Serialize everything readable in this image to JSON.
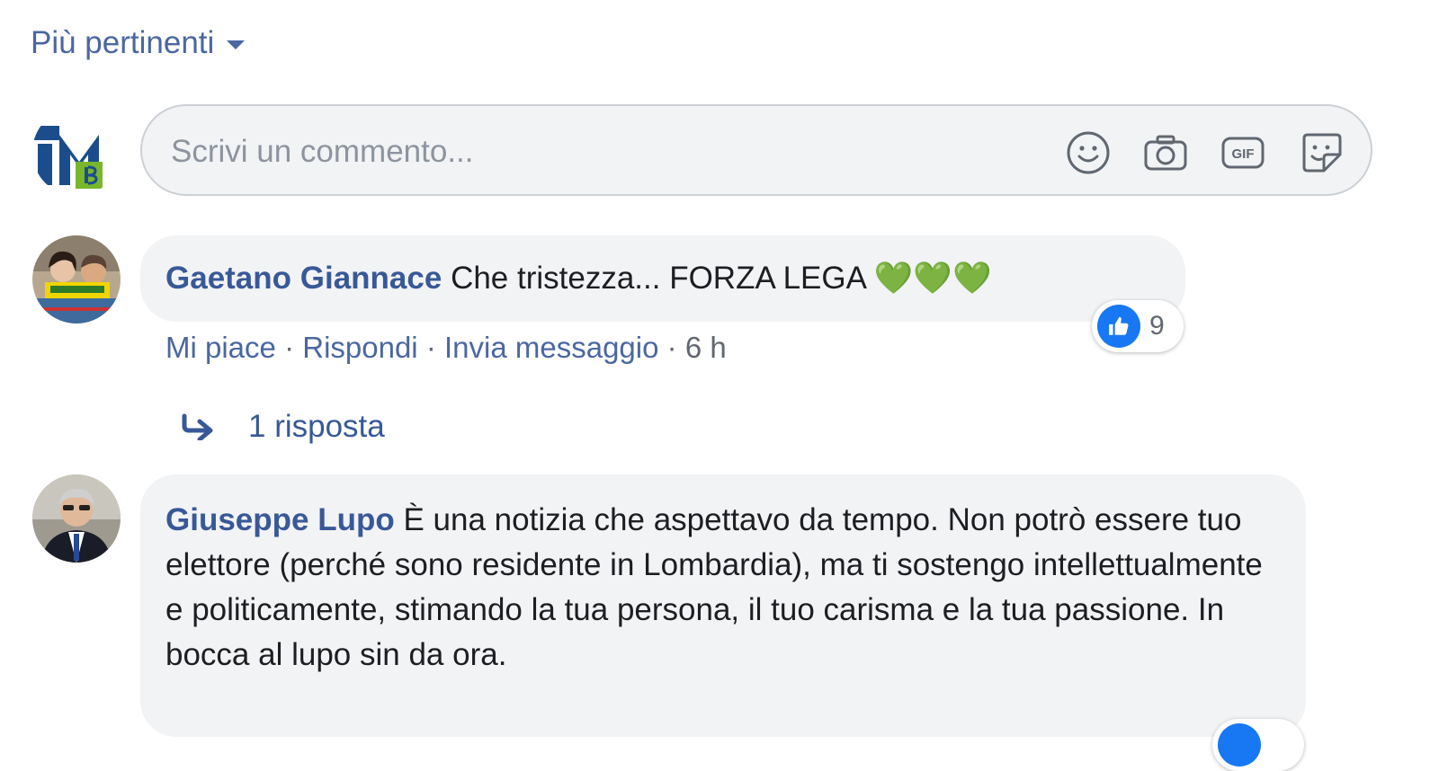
{
  "sort": {
    "label": "Più pertinenti"
  },
  "composer": {
    "placeholder": "Scrivi un commento...",
    "icons": [
      "emoji-icon",
      "camera-icon",
      "gif-icon",
      "sticker-icon"
    ],
    "gif_text": "GIF"
  },
  "comments": [
    {
      "author": "Gaetano Giannace",
      "text": "Che tristezza... FORZA LEGA",
      "emoji": "💚💚💚",
      "reactions": {
        "icon": "like-icon",
        "count": "9"
      },
      "actions": {
        "like": "Mi piace",
        "reply": "Rispondi",
        "message": "Invia messaggio",
        "time": "6 h",
        "separator": "·"
      },
      "replies_label": "1 risposta"
    },
    {
      "author": "Giuseppe Lupo",
      "text": "È una notizia che aspettavo da tempo. Non potrò essere tuo elettore (perché sono residente in Lombardia), ma ti sostengo intellettualmente e politicamente, stimando la tua persona, il tuo carisma e la tua passione. In bocca al lupo sin da ora."
    }
  ],
  "colors": {
    "link": "#385898",
    "bubble": "#f2f3f5",
    "like_blue": "#1877f2"
  }
}
